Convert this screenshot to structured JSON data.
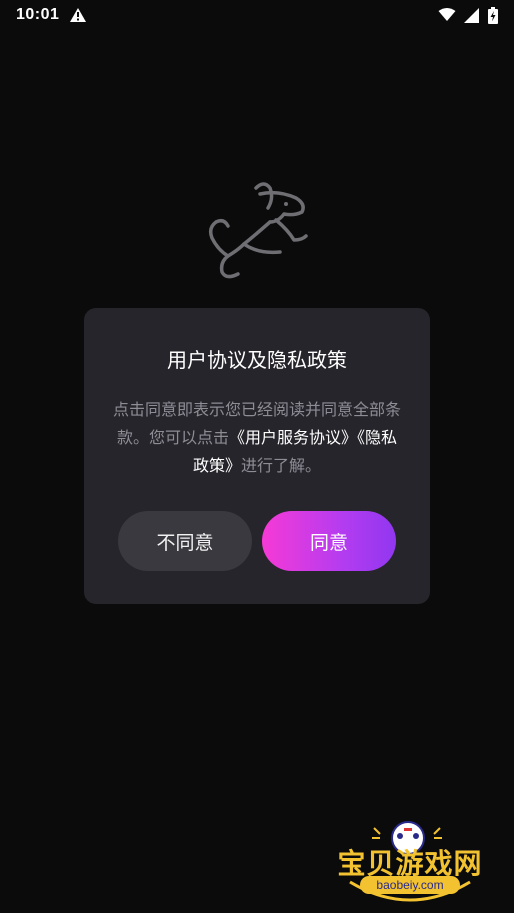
{
  "status_bar": {
    "time": "10:01",
    "icons": [
      "warning-icon",
      "wifi-icon",
      "signal-icon",
      "battery-charging-icon"
    ]
  },
  "dialog": {
    "title": "用户协议及隐私政策",
    "body_text_1": "点击同意即表示您已经阅读并同意全部条款。您可以点击",
    "link_user_agreement": "《用户服务协议》",
    "link_privacy_policy": "《隐私政策》",
    "body_text_2": "进行了解。",
    "disagree_label": "不同意",
    "agree_label": "同意"
  },
  "watermark": {
    "text": "宝贝游戏网",
    "url": "baobeiy.com"
  },
  "colors": {
    "background": "#0b0b0b",
    "dialog_background": "#26252b",
    "body_text": "#8e8c95",
    "agree_gradient_start": "#f63ad6",
    "agree_gradient_end": "#9137f0",
    "disagree_button": "#3a393f"
  }
}
